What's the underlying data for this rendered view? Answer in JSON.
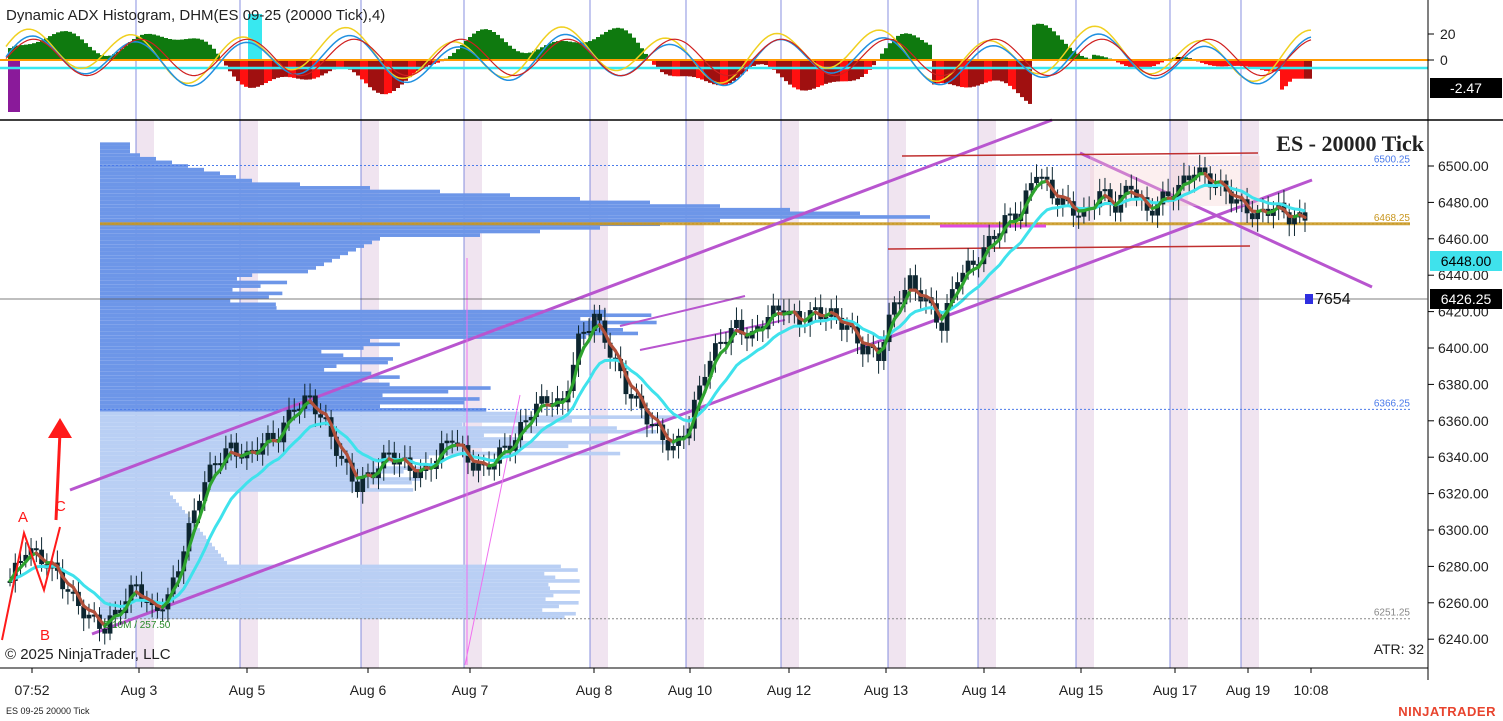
{
  "window": {
    "indicator_title": "Dynamic ADX Histogram, DHM(ES 09-25 (20000 Tick),4)",
    "watermark": "ES - 20000 Tick",
    "copyright": "© 2025 NinjaTrader, LLC",
    "instrument_label": "ES 09-25 20000 Tick",
    "brand": "NINJATRADER",
    "atr_label": "ATR: 32",
    "volume_label": "Σ  10M / 257.50",
    "count_label": "7654",
    "wave_labels": [
      "A",
      "B",
      "C"
    ]
  },
  "chart_data": [
    {
      "type": "bar",
      "name": "Dynamic ADX Histogram",
      "y_ticks": [
        20,
        0
      ],
      "ylim": [
        -35,
        40
      ],
      "current_value": -2.47,
      "colors": {
        "positive": "#0f7a0f",
        "negative": "#a01010",
        "bright_negative": "#ff1010",
        "neutral": "#000000",
        "zero_line": "#ff9a00",
        "signal_line": "#38e8f0"
      }
    },
    {
      "type": "line",
      "name": "ES 09-25 (20000 Tick)",
      "x_tick_labels": [
        "07:52",
        "Aug 3",
        "Aug 5",
        "Aug 6",
        "Aug 7",
        "Aug 8",
        "Aug 10",
        "Aug 12",
        "Aug 13",
        "Aug 14",
        "Aug 15",
        "Aug 17",
        "Aug 19",
        "10:08"
      ],
      "y_ticks": [
        6240,
        6260,
        6280,
        6300,
        6320,
        6340,
        6360,
        6380,
        6400,
        6420,
        6440,
        6460,
        6480,
        6500
      ],
      "ylim": [
        6230,
        6525
      ],
      "x": [
        0,
        3,
        6,
        9,
        12,
        15,
        18,
        21,
        24,
        27,
        30,
        33,
        36,
        39,
        42,
        45,
        48,
        51,
        54,
        57,
        60,
        63,
        66,
        69,
        72,
        75,
        78,
        81,
        84,
        87,
        90,
        93,
        96,
        99,
        102,
        105,
        108,
        111,
        114,
        117,
        120,
        123,
        126,
        129,
        132,
        135,
        138,
        141,
        144,
        147,
        150,
        153,
        156,
        159,
        162,
        165,
        168,
        171,
        174,
        177,
        180,
        183,
        186,
        189,
        192,
        195,
        198,
        201,
        204,
        207,
        210,
        213,
        216,
        219,
        222,
        225,
        228,
        231,
        234,
        237,
        240,
        243,
        246
      ],
      "close": [
        6272,
        6290,
        6284,
        6276,
        6262,
        6252,
        6246,
        6258,
        6270,
        6255,
        6262,
        6290,
        6320,
        6338,
        6345,
        6340,
        6348,
        6352,
        6368,
        6372,
        6358,
        6338,
        6324,
        6332,
        6342,
        6336,
        6330,
        6340,
        6352,
        6338,
        6333,
        6342,
        6350,
        6366,
        6372,
        6368,
        6404,
        6418,
        6398,
        6378,
        6366,
        6354,
        6344,
        6358,
        6388,
        6404,
        6412,
        6406,
        6418,
        6422,
        6414,
        6420,
        6418,
        6412,
        6400,
        6396,
        6424,
        6436,
        6426,
        6412,
        6440,
        6446,
        6458,
        6470,
        6475,
        6498,
        6484,
        6478,
        6472,
        6486,
        6478,
        6490,
        6474,
        6482,
        6488,
        6498,
        6492,
        6486,
        6478,
        6472,
        6478,
        6472,
        6470
      ],
      "levels": [
        {
          "label": "6500.25",
          "value": 6500.25,
          "color": "#4b7bea"
        },
        {
          "label": "6468.25",
          "value": 6468.25,
          "color": "#c8961e"
        },
        {
          "label": "6366.25",
          "value": 6366.25,
          "color": "#4b7bea"
        },
        {
          "label": "6251.25",
          "value": 6251.25,
          "color": "#888888"
        }
      ],
      "price_flags": [
        {
          "label": "6448.00",
          "value": 6448.0,
          "style": "cyan"
        },
        {
          "label": "6426.25",
          "value": 6426.25,
          "style": "black"
        }
      ],
      "colors": {
        "profile": "#6d96e8",
        "channel": "#b855cf",
        "fast_ma_up": "#2ea32e",
        "fast_ma_down": "#b0503a",
        "slow_ma": "#3fe2ec",
        "candles": "#0d2630",
        "session_band": "#ead8ea",
        "day_line": "#6a74d8"
      }
    }
  ]
}
